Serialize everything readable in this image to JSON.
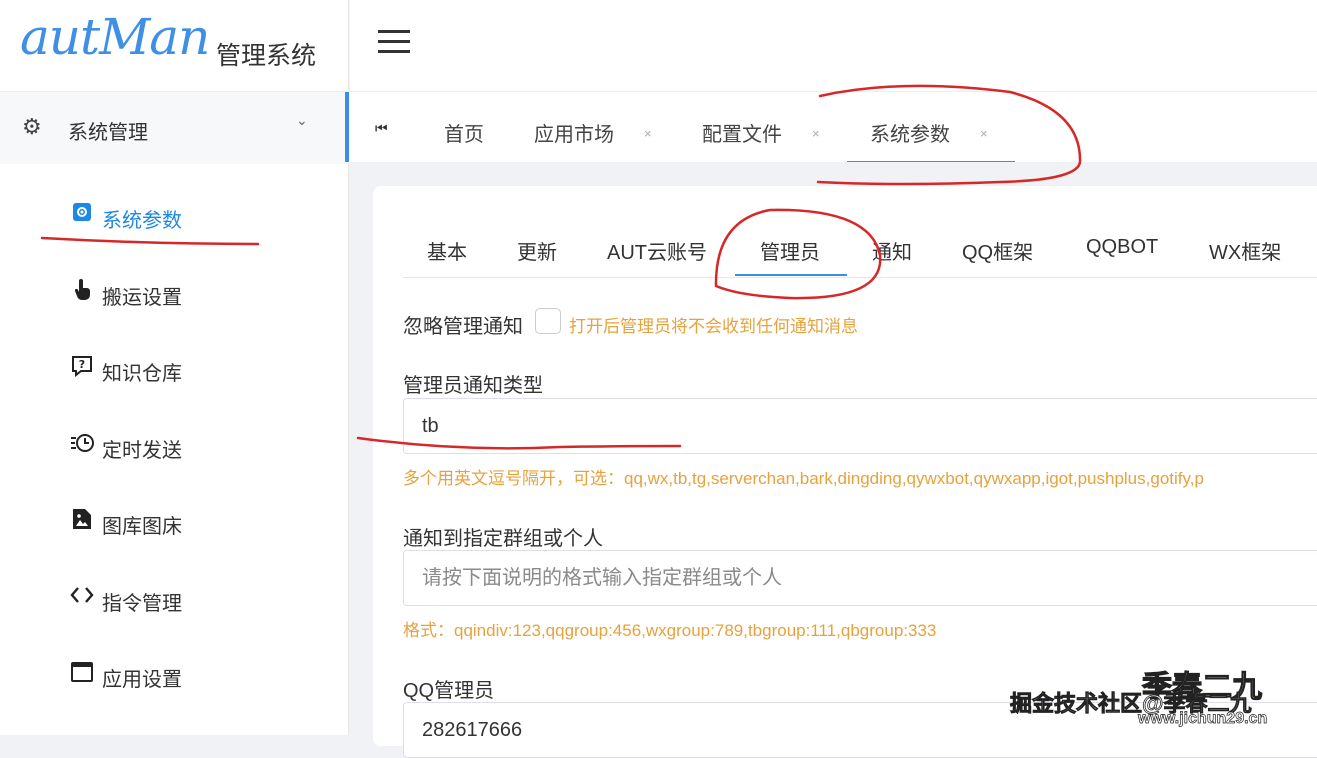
{
  "app": {
    "logo_script": "autMan",
    "logo_text": "管理系统"
  },
  "sidebar": {
    "group": {
      "icon": "gear-icon",
      "label": "系统管理"
    },
    "items": [
      {
        "icon": "gear-square-icon",
        "label": "系统参数",
        "active": true
      },
      {
        "icon": "hand-pointer-icon",
        "label": "搬运设置"
      },
      {
        "icon": "question-message-icon",
        "label": "知识仓库"
      },
      {
        "icon": "clock-list-icon",
        "label": "定时发送"
      },
      {
        "icon": "image-file-icon",
        "label": "图库图床"
      },
      {
        "icon": "code-icon",
        "label": "指令管理"
      },
      {
        "icon": "window-icon",
        "label": "应用设置"
      }
    ]
  },
  "tabs": {
    "first_icon": "⏮",
    "items": [
      {
        "label": "首页",
        "closable": false
      },
      {
        "label": "应用市场",
        "closable": true
      },
      {
        "label": "配置文件",
        "closable": true
      },
      {
        "label": "系统参数",
        "closable": true,
        "active": true
      }
    ],
    "close_glyph": "×"
  },
  "subtabs": [
    "基本",
    "更新",
    "AUT云账号",
    "管理员",
    "通知",
    "QQ框架",
    "QQBOT",
    "WX框架"
  ],
  "form": {
    "ignore_label": "忽略管理通知",
    "ignore_hint": "打开后管理员将不会收到任何通知消息",
    "type_label": "管理员通知类型",
    "type_value": "tb",
    "type_hint": "多个用英文逗号隔开，可选：qq,wx,tb,tg,serverchan,bark,dingding,qywxbot,qywxapp,igot,pushplus,gotify,p",
    "target_label": "通知到指定群组或个人",
    "target_placeholder": "请按下面说明的格式输入指定群组或个人",
    "target_hint": "格式：qqindiv:123,qqgroup:456,wxgroup:789,tbgroup:111,qbgroup:333",
    "qq_label": "QQ管理员",
    "qq_value": "282617666"
  },
  "watermark": {
    "big": "季春二九",
    "line1": "掘金技术社区@季春二九",
    "line2": "www.jichun29.cn"
  },
  "colors": {
    "accent": "#3a8ee6",
    "hint": "#e6a23c",
    "annotation": "#d62828"
  }
}
